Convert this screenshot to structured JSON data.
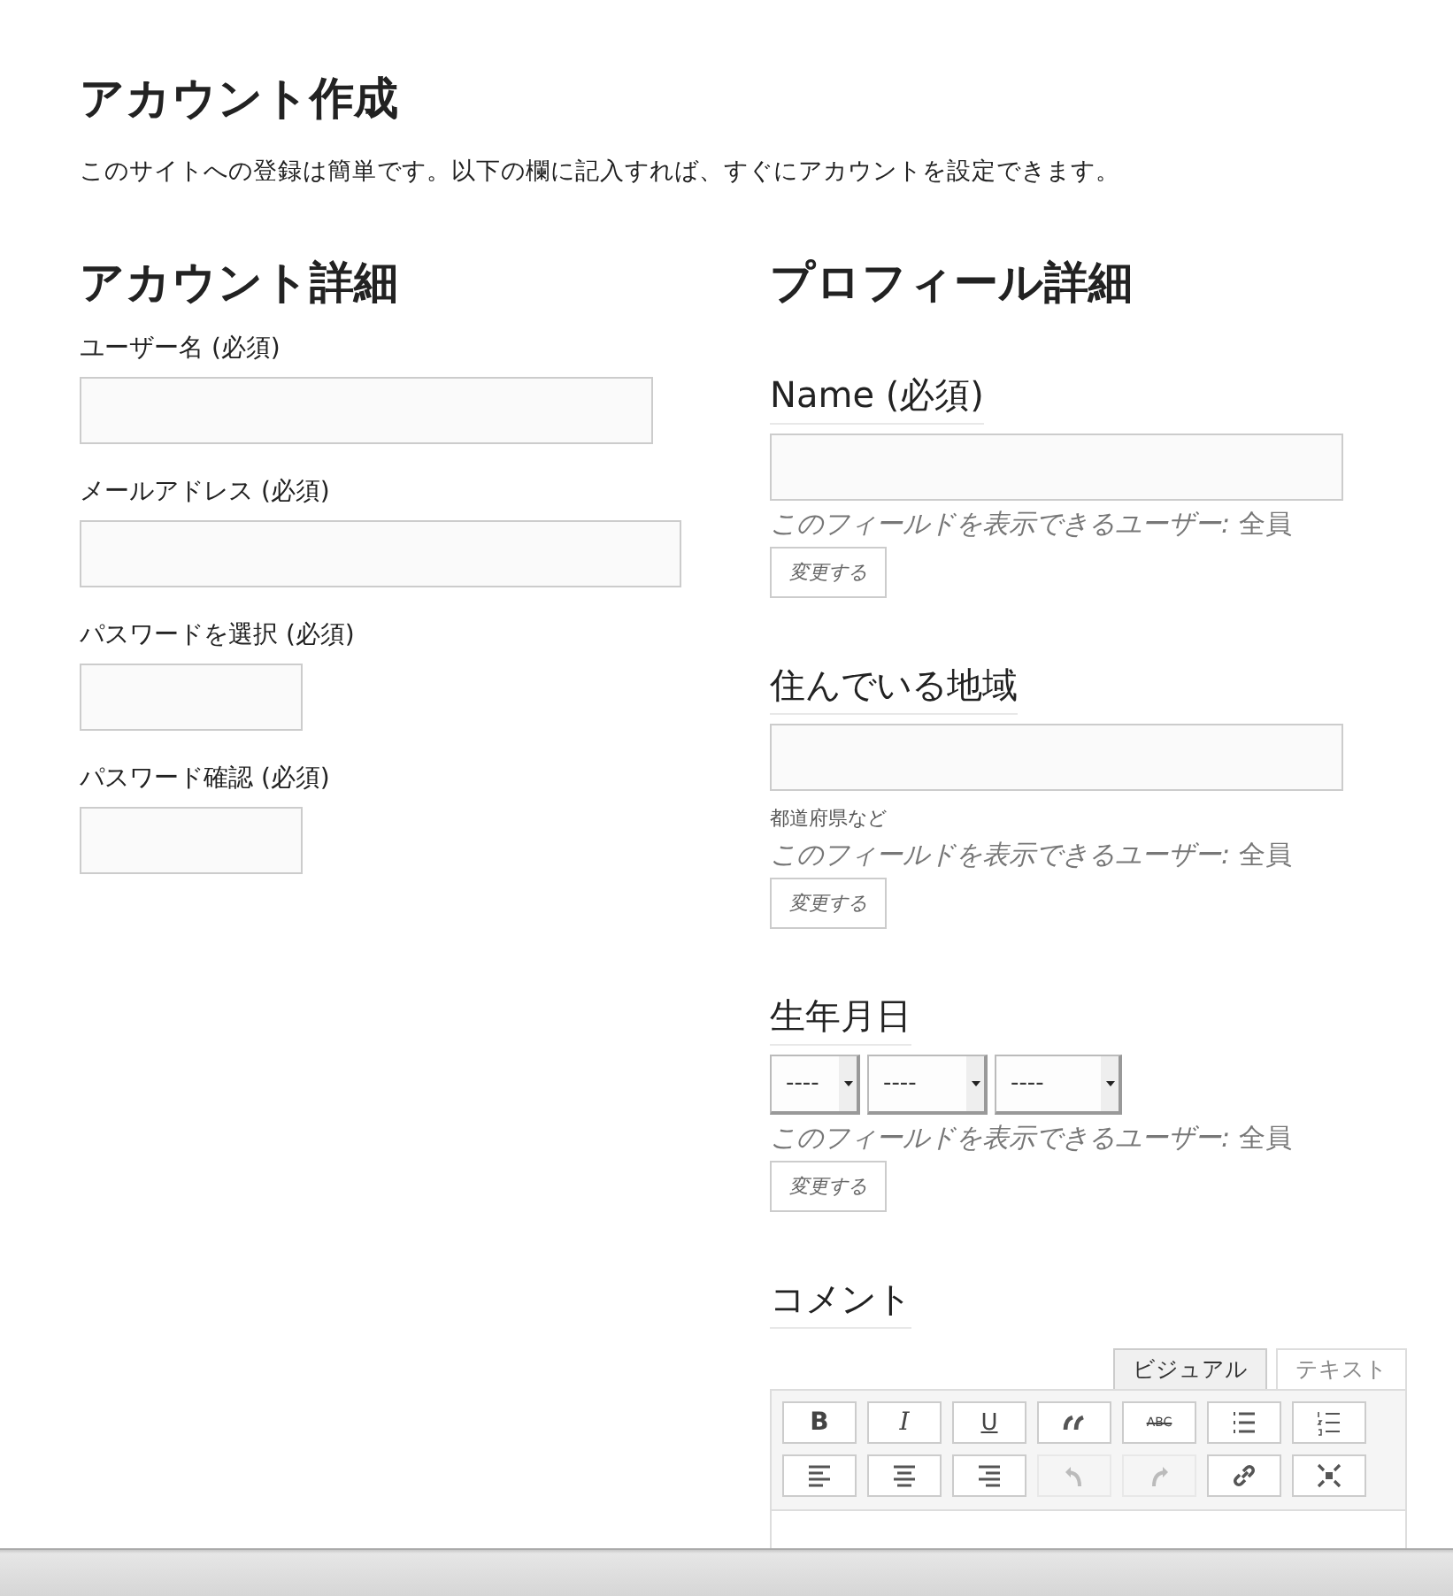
{
  "title": "アカウント作成",
  "intro": "このサイトへの登録は簡単です。以下の欄に記入すれば、すぐにアカウントを設定できます。",
  "account": {
    "heading": "アカウント詳細",
    "fields": [
      {
        "kind": "username",
        "label": "ユーザー名 (必須)"
      },
      {
        "kind": "email",
        "label": "メールアドレス (必須)"
      },
      {
        "kind": "password",
        "label": "パスワードを選択 (必須)"
      },
      {
        "kind": "password",
        "label": "パスワード確認 (必須)"
      }
    ]
  },
  "profile": {
    "heading": "プロフィール詳細",
    "fields": [
      {
        "kind": "text",
        "label": "Name (必須)",
        "visibility": "*このフィールドを表示できるユーザー:* 全員",
        "button": "変更する"
      },
      {
        "kind": "text",
        "label": "住んでいる地域",
        "description": "都道府県など",
        "visibility": "*このフィールドを表示できるユーザー:* 全員",
        "button": "変更する"
      },
      {
        "kind": "date",
        "label": "生年月日",
        "selects": [
          "----",
          "----",
          "----"
        ],
        "visibility": "*このフィールドを表示できるユーザー:* 全員",
        "button": "変更する"
      },
      {
        "kind": "editor",
        "label": "コメント",
        "tabs": [
          {
            "label": "ビジュアル",
            "selected": true
          },
          {
            "label": "テキスト",
            "selected": false
          }
        ],
        "toolbar": [
          {
            "kind": "bold",
            "label": "B",
            "disabled": false
          },
          {
            "kind": "italic",
            "label": "I",
            "disabled": false
          },
          {
            "kind": "underline",
            "label": "U",
            "disabled": false
          },
          {
            "kind": "quote",
            "disabled": false
          },
          {
            "kind": "strike",
            "label": "ABC",
            "disabled": false
          },
          {
            "kind": "bullets",
            "disabled": false
          },
          {
            "kind": "numbers",
            "disabled": false
          },
          {
            "kind": "align-left",
            "disabled": false
          },
          {
            "kind": "align-center",
            "disabled": false
          },
          {
            "kind": "align-right",
            "disabled": false
          },
          {
            "kind": "undo",
            "disabled": true
          },
          {
            "kind": "redo",
            "disabled": true
          },
          {
            "kind": "link",
            "disabled": false
          },
          {
            "kind": "fullscreen",
            "disabled": false
          }
        ]
      }
    ]
  }
}
